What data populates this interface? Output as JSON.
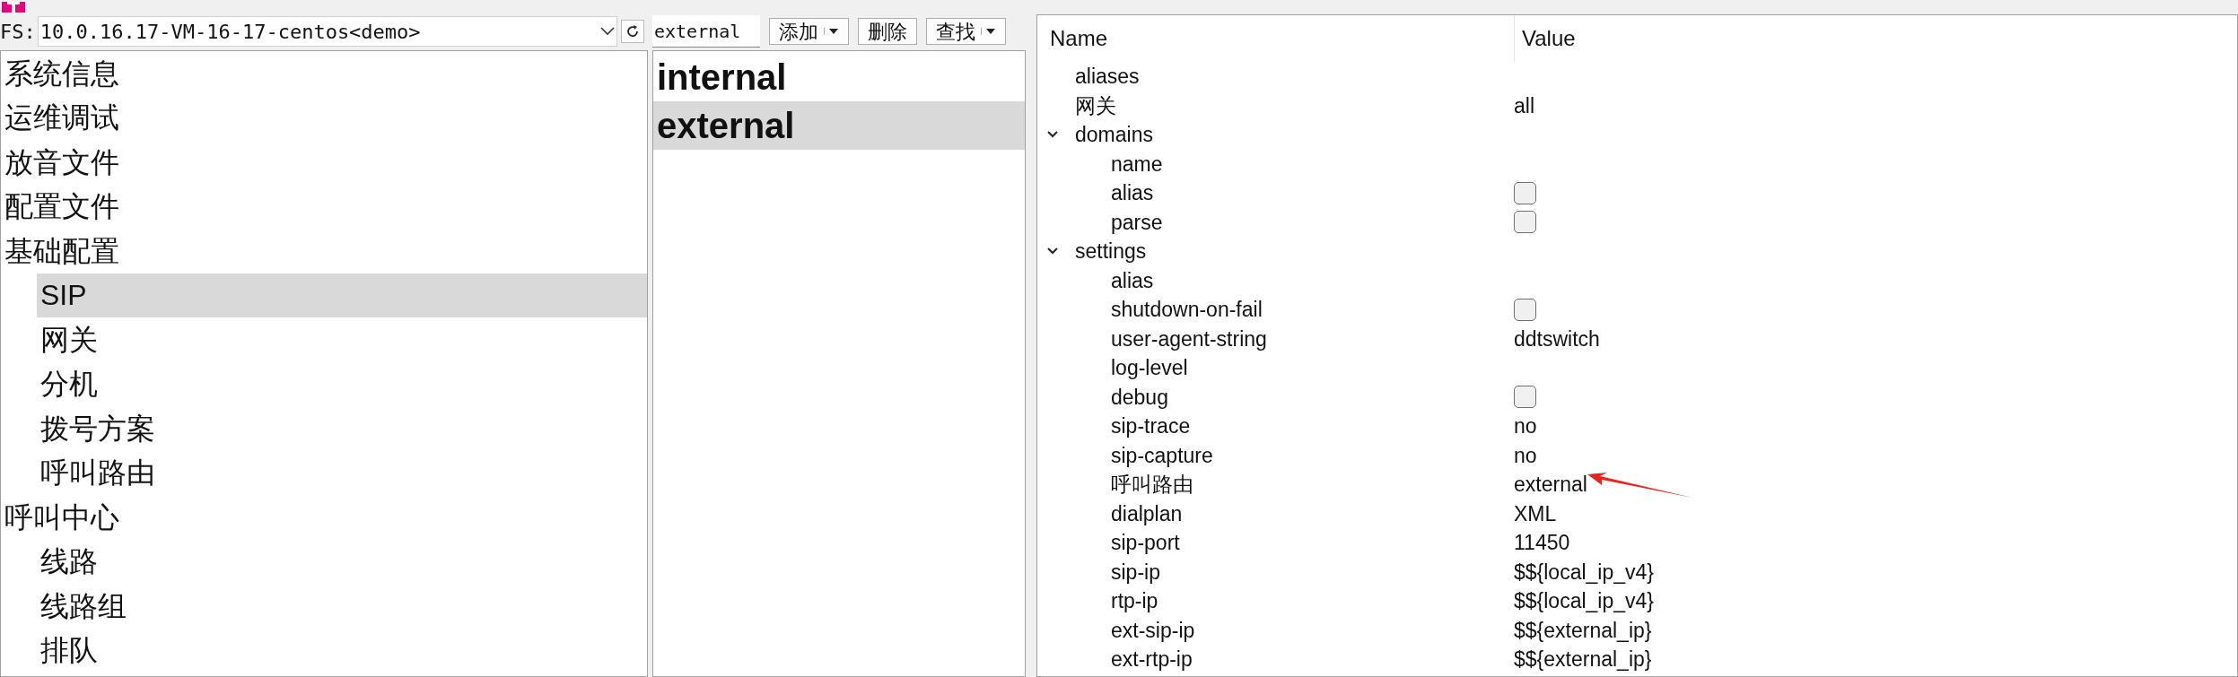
{
  "connection": {
    "label": "FS:",
    "value": "10.0.16.17-VM-16-17-centos<demo>"
  },
  "toolbar": {
    "search_value": "external",
    "buttons": [
      {
        "label": "添加",
        "dropdown": true
      },
      {
        "label": "删除",
        "dropdown": false
      },
      {
        "label": "查找",
        "dropdown": true
      }
    ]
  },
  "nav": [
    {
      "label": "系统信息",
      "selected": false
    },
    {
      "label": "运维调试",
      "selected": false
    },
    {
      "label": "放音文件",
      "selected": false
    },
    {
      "label": "配置文件",
      "selected": false
    },
    {
      "label": "基础配置",
      "selected": false,
      "children": [
        {
          "label": "SIP",
          "selected": true
        },
        {
          "label": "网关",
          "selected": false
        },
        {
          "label": "分机",
          "selected": false
        },
        {
          "label": "拨号方案",
          "selected": false
        },
        {
          "label": "呼叫路由",
          "selected": false
        }
      ]
    },
    {
      "label": "呼叫中心",
      "selected": false,
      "children": [
        {
          "label": "线路",
          "selected": false
        },
        {
          "label": "线路组",
          "selected": false
        },
        {
          "label": "排队",
          "selected": false
        }
      ]
    }
  ],
  "profiles": [
    {
      "label": "internal",
      "selected": false
    },
    {
      "label": "external",
      "selected": true
    }
  ],
  "properties": {
    "columns": [
      "Name",
      "Value"
    ],
    "rows": [
      {
        "name": "aliases",
        "kind": "text"
      },
      {
        "name": "网关",
        "kind": "text",
        "value": "all"
      },
      {
        "name": "domains",
        "kind": "group",
        "expanded": true,
        "children": [
          {
            "name": "name",
            "kind": "text"
          },
          {
            "name": "alias",
            "kind": "checkbox",
            "checked": false
          },
          {
            "name": "parse",
            "kind": "checkbox",
            "checked": false
          }
        ]
      },
      {
        "name": "settings",
        "kind": "group",
        "expanded": true,
        "children": [
          {
            "name": "alias",
            "kind": "text"
          },
          {
            "name": "shutdown-on-fail",
            "kind": "checkbox",
            "checked": false
          },
          {
            "name": "user-agent-string",
            "kind": "text",
            "value": "ddtswitch"
          },
          {
            "name": "log-level",
            "kind": "text"
          },
          {
            "name": "debug",
            "kind": "checkbox",
            "checked": false
          },
          {
            "name": "sip-trace",
            "kind": "text",
            "value": "no"
          },
          {
            "name": "sip-capture",
            "kind": "text",
            "value": "no"
          },
          {
            "name": "呼叫路由",
            "kind": "text",
            "value": "external",
            "annotated": true
          },
          {
            "name": "dialplan",
            "kind": "text",
            "value": "XML"
          },
          {
            "name": "sip-port",
            "kind": "text",
            "value": "11450"
          },
          {
            "name": "sip-ip",
            "kind": "text",
            "value": "$${local_ip_v4}"
          },
          {
            "name": "rtp-ip",
            "kind": "text",
            "value": "$${local_ip_v4}"
          },
          {
            "name": "ext-sip-ip",
            "kind": "text",
            "value": "$${external_ip}"
          },
          {
            "name": "ext-rtp-ip",
            "kind": "text",
            "value": "$${external_ip}"
          }
        ]
      }
    ]
  }
}
